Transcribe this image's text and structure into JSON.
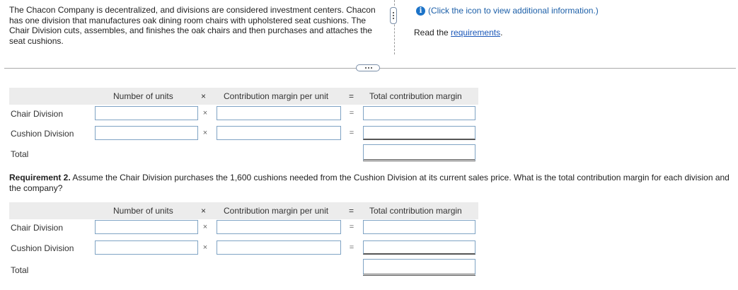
{
  "intro": {
    "text": "The Chacon Company is decentralized, and divisions are considered investment centers. Chacon has one division that manufactures oak dining room chairs with upholstered seat cushions. The Chair Division cuts, assembles, and finishes the oak chairs and then purchases and attaches the seat cushions."
  },
  "info": {
    "icon": "info-icon",
    "click_text": "(Click the icon to view additional information.)",
    "read_prefix": "Read the ",
    "read_link": "requirements",
    "read_suffix": "."
  },
  "table_headers": {
    "units": "Number of units",
    "times": "×",
    "cm_per_unit": "Contribution margin per unit",
    "equals": "=",
    "total_cm": "Total contribution margin"
  },
  "table1": {
    "rows": [
      {
        "label": "Chair Division"
      },
      {
        "label": "Cushion Division"
      }
    ],
    "total_label": "Total"
  },
  "requirement2": {
    "bold": "Requirement 2.",
    "text": " Assume the Chair Division purchases the 1,600 cushions needed from the Cushion Division at its current sales price. What is the total contribution margin for each division and the company?"
  },
  "table2": {
    "rows": [
      {
        "label": "Chair Division"
      },
      {
        "label": "Cushion Division"
      }
    ],
    "total_label": "Total"
  }
}
